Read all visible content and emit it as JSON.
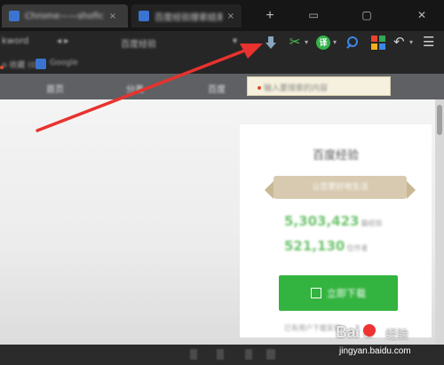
{
  "tabs": [
    {
      "title": "Chrome——shofic",
      "close": "×",
      "active": true
    },
    {
      "title": "百度经验搜索结果下载",
      "close": "×",
      "active": false
    }
  ],
  "tabbar": {
    "new_tab": "+",
    "minimize": "▭",
    "restore": "▢",
    "close": "✕"
  },
  "toolbar": {
    "address_fragment": "kword",
    "nav_fragment": "◂ ▸",
    "page_text": "百度经验",
    "icons": [
      "download-icon",
      "scissors-icon",
      "translate-icon",
      "search-icon",
      "apps-icon",
      "undo-icon",
      "menu-icon"
    ],
    "translate_label": "译",
    "scissors_glyph": "✂",
    "undo_glyph": "↶",
    "menu_glyph": "☰",
    "caret": "▾"
  },
  "bookmarks": {
    "left_text": "o 收藏 (0)",
    "item": "Google"
  },
  "nav": {
    "items": [
      "首页",
      "分类",
      "百度"
    ],
    "search_text": "输入要搜索的内容"
  },
  "panel": {
    "title": "百度经验",
    "ribbon": "让您更好地生活",
    "stat1": "5,303,423",
    "stat1_unit": "篇经验",
    "stat2": "521,130",
    "stat2_unit": "位作者",
    "button": "立即下载",
    "footer": "已有用户下载安装"
  },
  "watermark": {
    "brand": "Bai  u",
    "cn": "经验",
    "url": "jingyan.baidu.com"
  },
  "colors": {
    "arrow": "#e8322e",
    "accent_green": "#33b33f",
    "link_blue": "#3e86e6"
  }
}
